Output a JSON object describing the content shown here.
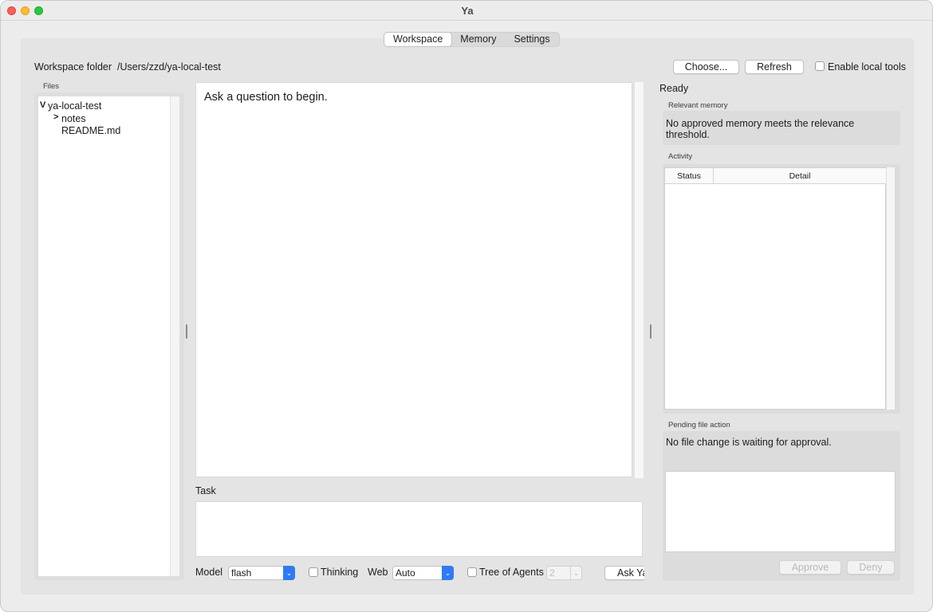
{
  "window": {
    "title": "Ya"
  },
  "tabs": [
    {
      "label": "Workspace",
      "active": true
    },
    {
      "label": "Memory",
      "active": false
    },
    {
      "label": "Settings",
      "active": false
    }
  ],
  "workspace": {
    "folder_label": "Workspace folder",
    "folder_path": "/Users/zzd/ya-local-test",
    "choose_label": "Choose...",
    "refresh_label": "Refresh",
    "enable_local_tools_label": "Enable local tools",
    "enable_local_tools_checked": false
  },
  "files": {
    "section_label": "Files",
    "tree": [
      {
        "name": "ya-local-test",
        "expanded": true,
        "chevron": "V"
      },
      {
        "name": "notes",
        "expanded": false,
        "chevron": ">"
      },
      {
        "name": "README.md"
      }
    ]
  },
  "answer": {
    "placeholder_text": "Ask a question to begin."
  },
  "task": {
    "label": "Task",
    "value": ""
  },
  "controls": {
    "model_label": "Model",
    "model_value": "flash",
    "thinking_label": "Thinking",
    "thinking_checked": false,
    "web_label": "Web",
    "web_value": "Auto",
    "tree_of_agents_label": "Tree of Agents",
    "tree_of_agents_checked": false,
    "agents_count": "2",
    "ask_button_label": "Ask Ya"
  },
  "status": {
    "text": "Ready"
  },
  "memory": {
    "section_label": "Relevant memory",
    "text": "No approved memory meets the relevance threshold."
  },
  "activity": {
    "section_label": "Activity",
    "columns": [
      "Status",
      "Detail"
    ],
    "rows": []
  },
  "pending": {
    "section_label": "Pending file action",
    "text": "No file change is waiting for approval.",
    "approve_label": "Approve",
    "deny_label": "Deny"
  },
  "colors": {
    "accent": "#2f7bf5",
    "close": "#fe5f57",
    "minimize": "#febc2e",
    "maximize": "#28c840"
  }
}
